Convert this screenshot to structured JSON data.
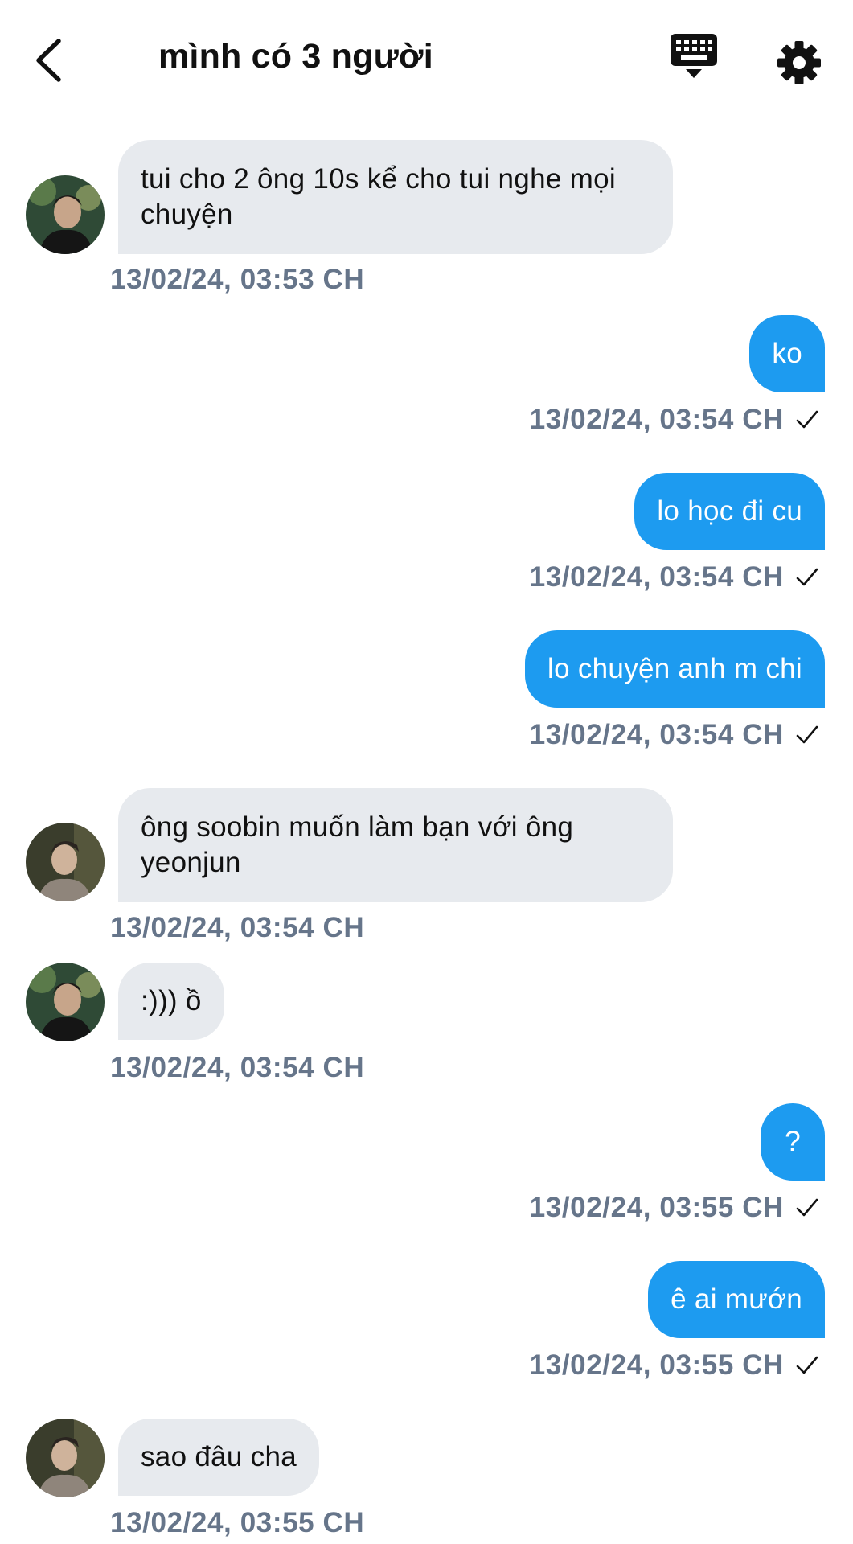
{
  "header": {
    "title": "mình có 3 người",
    "back_icon": "back-chevron-icon",
    "keyboard_icon": "keyboard-icon",
    "settings_icon": "gear-icon"
  },
  "colors": {
    "outgoing_bubble": "#1d9bf0",
    "incoming_bubble": "#e7eaee",
    "timestamp": "#66758a"
  },
  "messages": [
    {
      "direction": "in",
      "text": "tui cho 2 ông 10s kể cho tui nghe mọi chuyện",
      "time": "13/02/24, 03:53 CH"
    },
    {
      "direction": "out",
      "text": "ko",
      "time": "13/02/24, 03:54 CH",
      "status": "sent-check-icon"
    },
    {
      "direction": "out",
      "text": "lo học đi cu",
      "time": "13/02/24, 03:54 CH",
      "status": "sent-check-icon"
    },
    {
      "direction": "out",
      "text": "lo chuyện anh m chi",
      "time": "13/02/24, 03:54 CH",
      "status": "sent-check-icon"
    },
    {
      "direction": "in",
      "text": "ông soobin muốn làm bạn với ông yeonjun",
      "time": "13/02/24, 03:54 CH"
    },
    {
      "direction": "in",
      "text": ":))) ồ",
      "time": "13/02/24, 03:54 CH"
    },
    {
      "direction": "out",
      "text": "?",
      "time": "13/02/24, 03:55 CH",
      "status": "sent-check-icon"
    },
    {
      "direction": "out",
      "text": "ê ai mướn",
      "time": "13/02/24, 03:55 CH",
      "status": "sent-check-icon"
    },
    {
      "direction": "in",
      "text": "sao đâu cha",
      "time": "13/02/24, 03:55 CH"
    }
  ]
}
